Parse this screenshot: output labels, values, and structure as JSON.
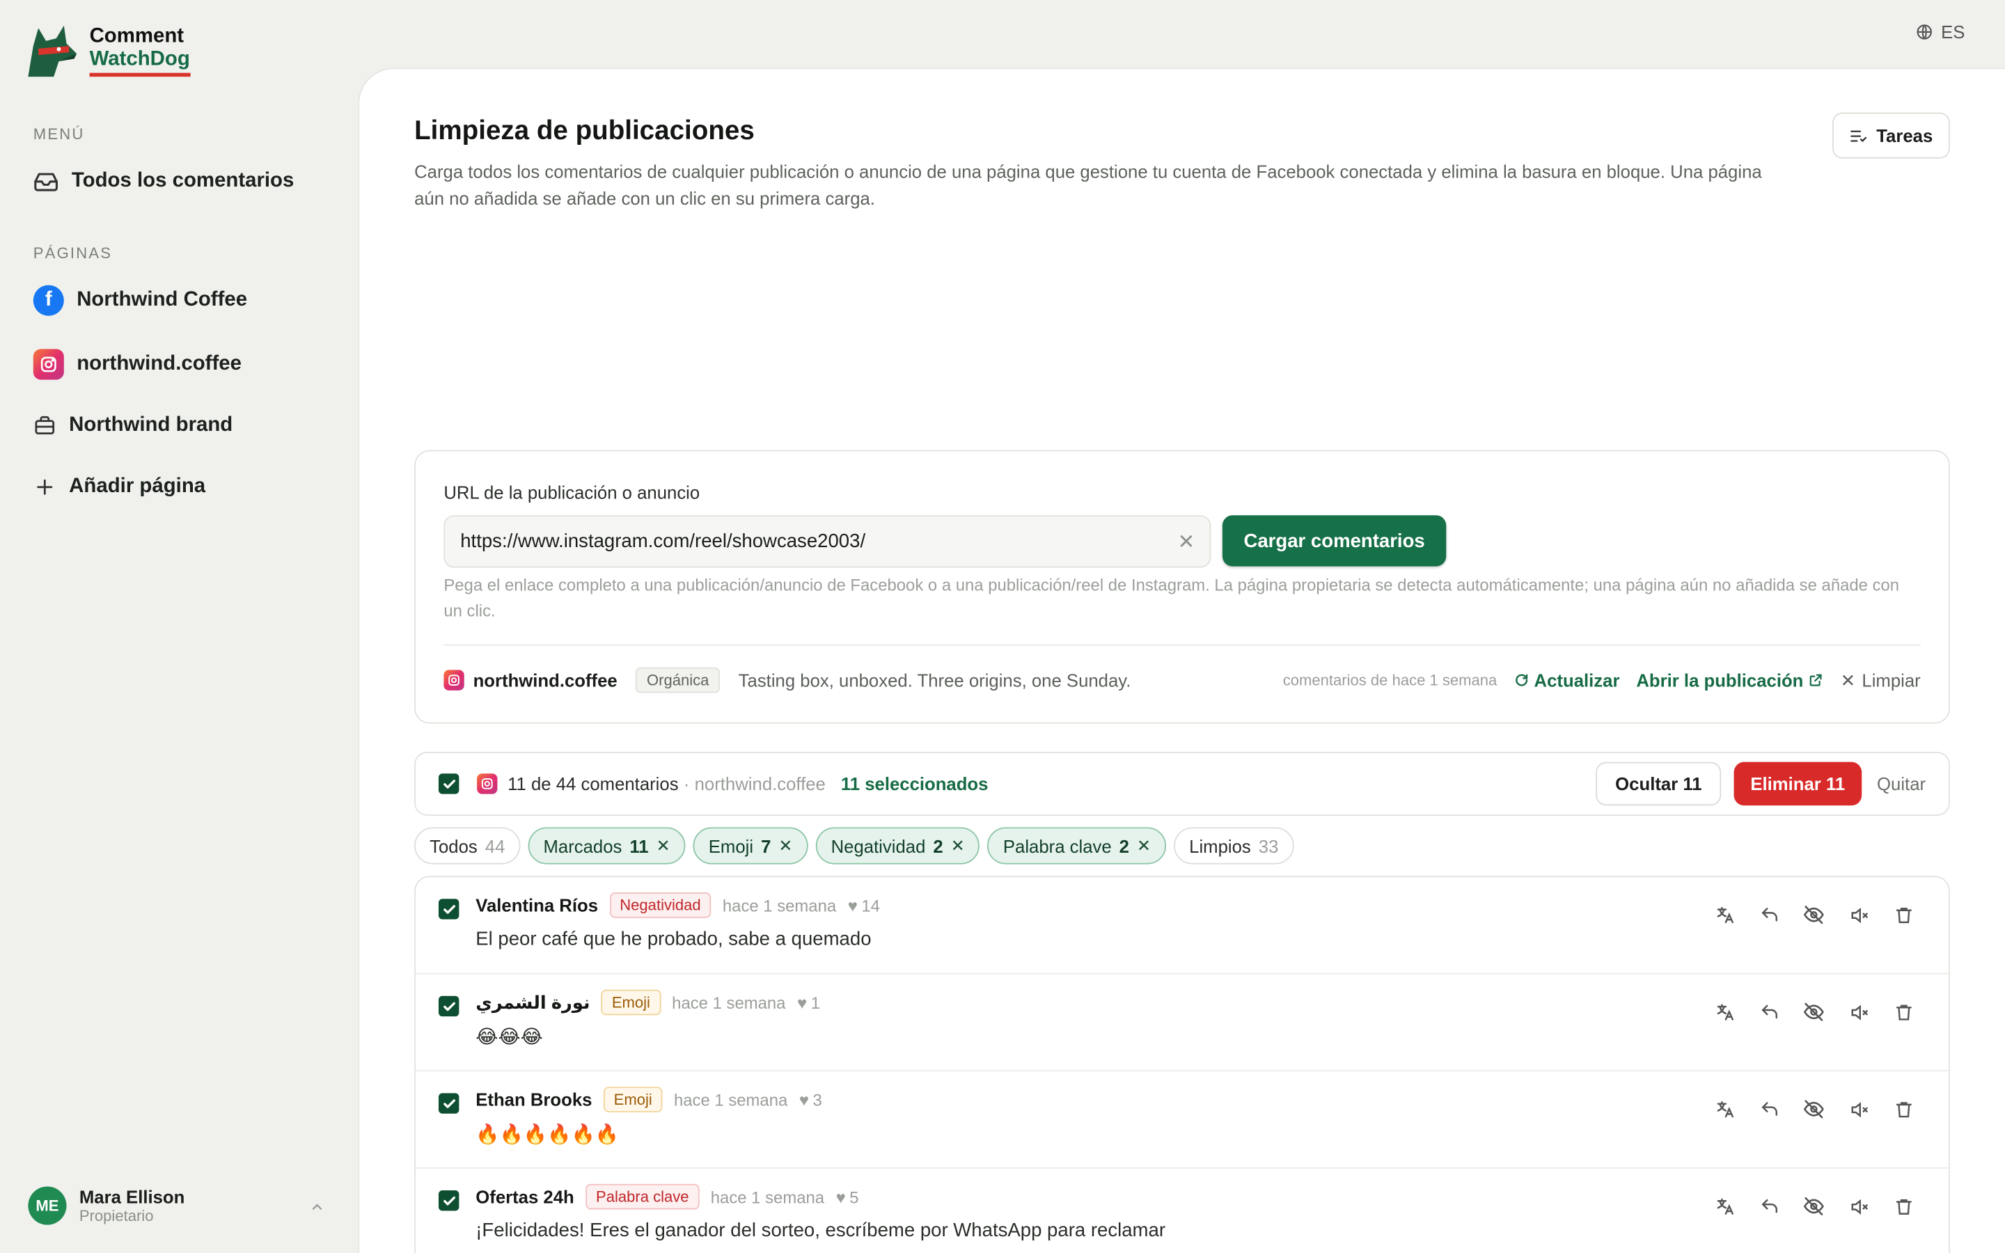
{
  "app": {
    "name_line1": "Comment",
    "name_line2": "WatchDog"
  },
  "sidebar": {
    "menu_label": "MENÚ",
    "all_comments": "Todos los comentarios",
    "pages_label": "PÁGINAS",
    "pages": [
      {
        "label": "Northwind Coffee",
        "platform": "facebook"
      },
      {
        "label": "northwind.coffee",
        "platform": "instagram"
      },
      {
        "label": "Northwind brand",
        "platform": "briefcase"
      }
    ],
    "add_page": "Añadir página",
    "user": {
      "initials": "ME",
      "name": "Mara Ellison",
      "role": "Propietario"
    }
  },
  "topbar": {
    "language": "ES"
  },
  "main": {
    "title": "Limpieza de publicaciones",
    "description": "Carga todos los comentarios de cualquier publicación o anuncio de una página que gestione tu cuenta de Facebook conectada y elimina la basura en bloque. Una página aún no añadida se añade con un clic en su primera carga.",
    "tasks_button": "Tareas",
    "url_card": {
      "label": "URL de la publicación o anuncio",
      "url_value": "https://www.instagram.com/reel/showcase2003/",
      "load_button": "Cargar comentarios",
      "hint": "Pega el enlace completo a una publicación/anuncio de Facebook o a una publicación/reel de Instagram. La página propietaria se detecta automáticamente; una página aún no añadida se añade con un clic.",
      "post": {
        "owner": "northwind.coffee",
        "type": "Orgánica",
        "caption": "Tasting box, unboxed. Three origins, one Sunday.",
        "freshness": "comentarios de hace 1 semana",
        "refresh": "Actualizar",
        "open": "Abrir la publicación",
        "clear": "Limpiar"
      }
    },
    "selection": {
      "count": "11 de 44 comentarios",
      "owner": "· northwind.coffee",
      "selected": "11 seleccionados",
      "hide": "Ocultar 11",
      "delete": "Eliminar 11",
      "remove": "Quitar"
    },
    "filters": [
      {
        "label": "Todos",
        "count": "44",
        "active": false
      },
      {
        "label": "Marcados",
        "count": "11",
        "active": true
      },
      {
        "label": "Emoji",
        "count": "7",
        "active": true
      },
      {
        "label": "Negatividad",
        "count": "2",
        "active": true
      },
      {
        "label": "Palabra clave",
        "count": "2",
        "active": true
      },
      {
        "label": "Limpios",
        "count": "33",
        "active": false
      }
    ],
    "comments": [
      {
        "author": "Valentina Ríos",
        "badge": "Negatividad",
        "time": "hace 1 semana",
        "likes": "14",
        "text": "El peor café que he probado, sabe a quemado"
      },
      {
        "author": "نورة الشمري",
        "badge": "Emoji",
        "time": "hace 1 semana",
        "likes": "1",
        "text": "😂😂😂"
      },
      {
        "author": "Ethan Brooks",
        "badge": "Emoji",
        "time": "hace 1 semana",
        "likes": "3",
        "text": "🔥🔥🔥🔥🔥🔥"
      },
      {
        "author": "Ofertas 24h",
        "badge": "Palabra clave",
        "time": "hace 1 semana",
        "likes": "5",
        "text": "¡Felicidades! Eres el ganador del sorteo, escríbeme por WhatsApp para reclamar"
      }
    ]
  },
  "colors": {
    "brand_green": "#167048",
    "danger_red": "#d92a2a",
    "selected_green": "#176b45"
  },
  "icons": [
    "globe-icon",
    "inbox-icon",
    "facebook-icon",
    "instagram-icon",
    "briefcase-icon",
    "plus-icon",
    "list-check-icon",
    "close-icon",
    "refresh-icon",
    "external-link-icon",
    "check-icon",
    "heart-icon",
    "translate-icon",
    "reply-icon",
    "eye-off-icon",
    "mute-icon",
    "trash-icon",
    "chevron-up-icon"
  ]
}
